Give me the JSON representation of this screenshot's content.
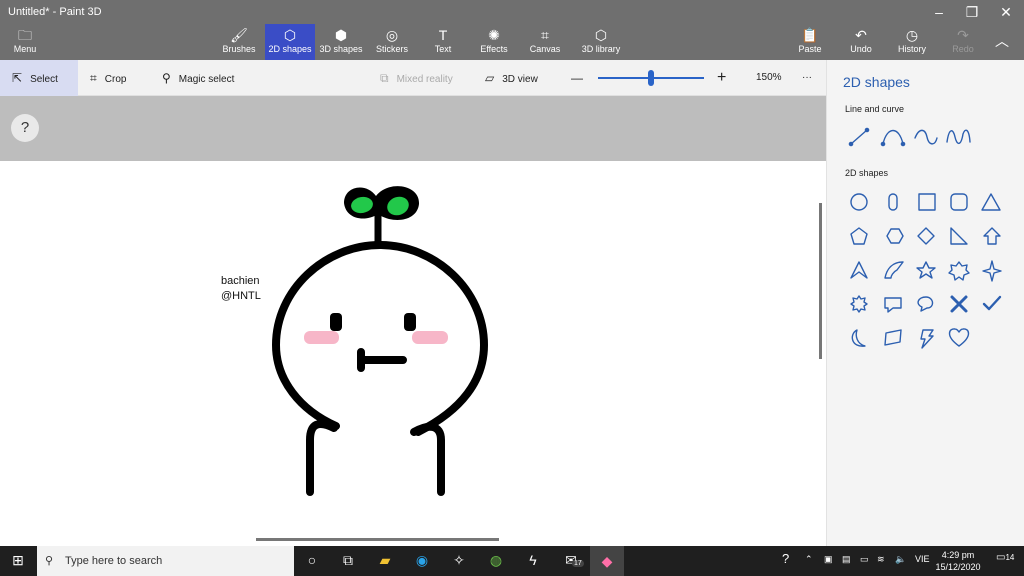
{
  "window": {
    "title": "Untitled* - Paint 3D",
    "minimize": "–",
    "maximize": "❐",
    "close": "✕"
  },
  "ribbon": {
    "menu": "Menu",
    "tools": [
      "Brushes",
      "2D shapes",
      "3D shapes",
      "Stickers",
      "Text",
      "Effects",
      "Canvas",
      "3D library"
    ],
    "paste": "Paste",
    "undo": "Undo",
    "history": "History",
    "redo": "Redo"
  },
  "toolbar": {
    "select": "Select",
    "crop": "Crop",
    "magic_select": "Magic select",
    "mixed_reality": "Mixed reality",
    "view_3d": "3D view",
    "zoom_minus": "—",
    "zoom_plus": "+",
    "zoom_level": "150%",
    "more": "···",
    "zoom_fraction": 0.5
  },
  "canvas": {
    "help": "?",
    "caption_line1": "bachien",
    "caption_line2": "@HNTL",
    "sprout_color": "#22c84a",
    "blush_color": "#f7b6c8"
  },
  "panel": {
    "title": "2D shapes",
    "line_section": "Line and curve",
    "shapes_section": "2D shapes",
    "accent": "#2c5fb0"
  },
  "taskbar": {
    "search_placeholder": "Type here to search",
    "mail_badge": "17",
    "language": "VIE",
    "time": "4:29 pm",
    "date": "15/12/2020",
    "notifications": "14"
  }
}
